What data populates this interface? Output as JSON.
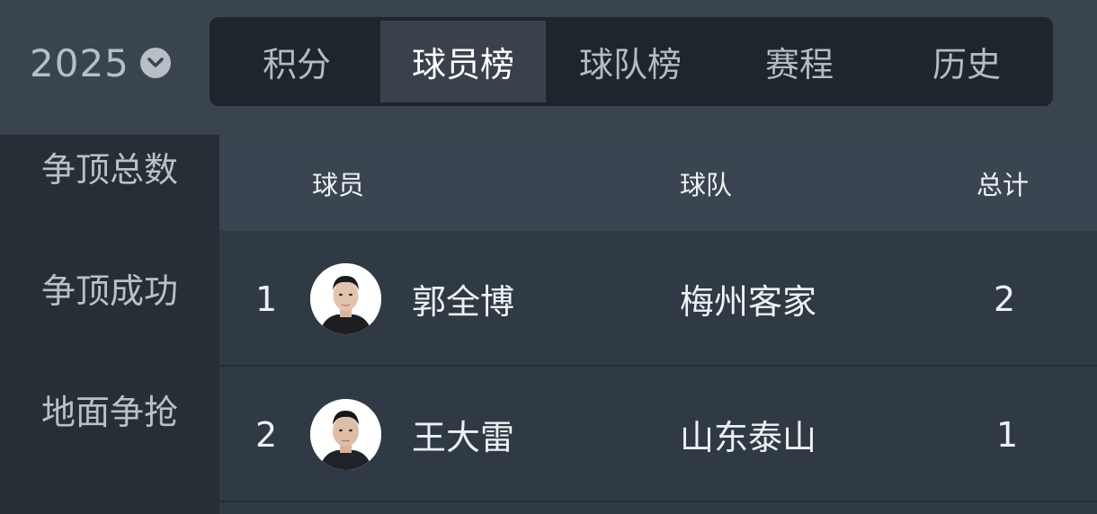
{
  "header": {
    "year": "2025",
    "tabs": [
      {
        "label": "积分",
        "active": false
      },
      {
        "label": "球员榜",
        "active": true
      },
      {
        "label": "球队榜",
        "active": false
      },
      {
        "label": "赛程",
        "active": false
      },
      {
        "label": "历史",
        "active": false
      }
    ]
  },
  "sidebar": {
    "items": [
      {
        "label": "争顶总数"
      },
      {
        "label": "争顶成功"
      },
      {
        "label": "地面争抢"
      }
    ]
  },
  "table": {
    "headers": {
      "player": "球员",
      "team": "球队",
      "total": "总计"
    },
    "rows": [
      {
        "rank": "1",
        "player": "郭全博",
        "team": "梅州客家",
        "total": "2"
      },
      {
        "rank": "2",
        "player": "王大雷",
        "team": "山东泰山",
        "total": "1"
      }
    ]
  },
  "colors": {
    "accent_tab_active": "#39424c",
    "background": "#2c353e"
  },
  "icons": {
    "year_dropdown": "chevron-down-icon",
    "avatar": "player-avatar"
  }
}
